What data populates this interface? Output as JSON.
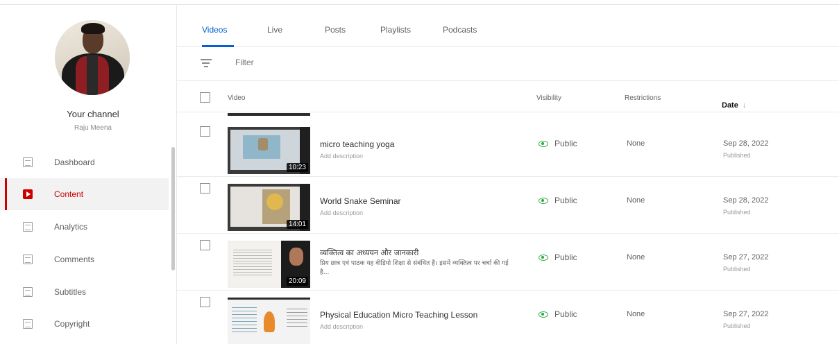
{
  "channel": {
    "title": "Your channel",
    "name": "Raju Meena"
  },
  "nav": {
    "items": [
      {
        "label": "Dashboard",
        "icon": "dashboard-icon"
      },
      {
        "label": "Content",
        "icon": "content-icon",
        "active": true
      },
      {
        "label": "Analytics",
        "icon": "analytics-icon"
      },
      {
        "label": "Comments",
        "icon": "comments-icon"
      },
      {
        "label": "Subtitles",
        "icon": "subtitles-icon"
      },
      {
        "label": "Copyright",
        "icon": "copyright-icon"
      }
    ]
  },
  "tabs": [
    "Videos",
    "Live",
    "Posts",
    "Playlists",
    "Podcasts"
  ],
  "active_tab": "Videos",
  "filter": {
    "placeholder": "Filter"
  },
  "table": {
    "headers": {
      "video": "Video",
      "visibility": "Visibility",
      "restrictions": "Restrictions",
      "date": "Date",
      "date_sort_arrow": "↓"
    },
    "rows": [
      {
        "title": "micro teaching yoga",
        "description": "Add description",
        "duration": "10:23",
        "visibility": "Public",
        "restrictions": "None",
        "date": "Sep 28, 2022",
        "status": "Published"
      },
      {
        "title": "World Snake Seminar",
        "description": "Add description",
        "duration": "14:01",
        "visibility": "Public",
        "restrictions": "None",
        "date": "Sep 28, 2022",
        "status": "Published"
      },
      {
        "title": "व्यक्तित्व का अध्ययन और जानकारी",
        "description": "प्रिय छात्र एवं पाठक यह वीडियो शिक्षा से संबंधित है। इसमें व्यक्तित्व पर चर्चा की गई है...",
        "duration": "20:09",
        "visibility": "Public",
        "restrictions": "None",
        "date": "Sep 27, 2022",
        "status": "Published"
      },
      {
        "title": "Physical Education Micro Teaching Lesson",
        "description": "Add description",
        "duration": "",
        "visibility": "Public",
        "restrictions": "None",
        "date": "Sep 27, 2022",
        "status": "Published"
      }
    ]
  },
  "colors": {
    "accent_blue": "#065fd4",
    "active_red": "#cc0000",
    "public_green": "#2ba640"
  }
}
